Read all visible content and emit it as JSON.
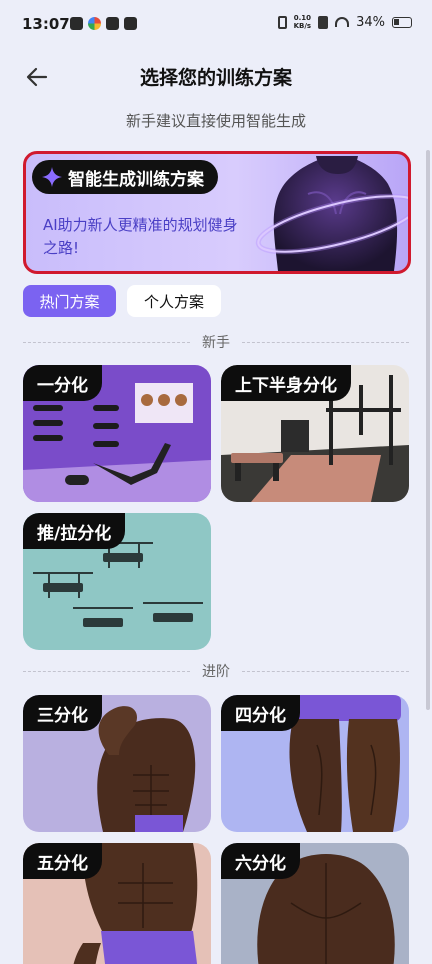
{
  "status_bar": {
    "time": "13:07",
    "net_speed_value": "0.10",
    "net_speed_unit": "KB/s",
    "battery": "34%"
  },
  "header": {
    "title": "选择您的训练方案",
    "subtitle": "新手建议直接使用智能生成"
  },
  "ai_banner": {
    "title": "智能生成训练方案",
    "description": "AI助力新人更精准的规划健身之路!",
    "accent_color": "#7b63f1",
    "highlight_border_color": "#d0192e"
  },
  "tabs": [
    {
      "label": "热门方案",
      "selected": true
    },
    {
      "label": "个人方案",
      "selected": false
    }
  ],
  "sections": [
    {
      "title": "新手",
      "plans": [
        {
          "label": "一分化",
          "image": "gym-room-purple-bench"
        },
        {
          "label": "上下半身分化",
          "image": "gym-room-squat-rack"
        },
        {
          "label": "推/拉分化",
          "image": "gym-benches-teal-floor"
        }
      ]
    },
    {
      "title": "进阶",
      "plans": [
        {
          "label": "三分化",
          "image": "athlete-torso-flex"
        },
        {
          "label": "四分化",
          "image": "athlete-legs"
        },
        {
          "label": "五分化",
          "image": "athlete-abs-purple-shorts"
        },
        {
          "label": "六分化",
          "image": "athlete-back"
        }
      ]
    }
  ]
}
